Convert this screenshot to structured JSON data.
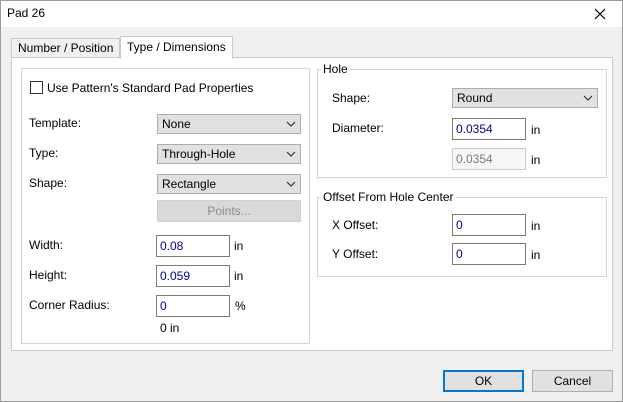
{
  "window": {
    "title": "Pad 26"
  },
  "tabs": [
    {
      "label": "Number / Position"
    },
    {
      "label": "Type / Dimensions"
    }
  ],
  "pad": {
    "use_standard_label": "Use Pattern's Standard Pad Properties",
    "use_standard_checked": false,
    "template_label": "Template:",
    "template_value": "None",
    "type_label": "Type:",
    "type_value": "Through-Hole",
    "shape_label": "Shape:",
    "shape_value": "Rectangle",
    "points_button": "Points...",
    "width_label": "Width:",
    "width_value": "0.08",
    "width_unit": "in",
    "height_label": "Height:",
    "height_value": "0.059",
    "height_unit": "in",
    "corner_label": "Corner Radius:",
    "corner_value": "0",
    "corner_unit": "%",
    "corner_computed": "0 in"
  },
  "hole": {
    "group_title": "Hole",
    "shape_label": "Shape:",
    "shape_value": "Round",
    "diameter_label": "Diameter:",
    "diameter_value": "0.0354",
    "diameter_unit": "in",
    "secondary_value": "0.0354",
    "secondary_unit": "in"
  },
  "offset": {
    "group_title": "Offset From Hole Center",
    "x_label": "X Offset:",
    "x_value": "0",
    "x_unit": "in",
    "y_label": "Y Offset:",
    "y_value": "0",
    "y_unit": "in"
  },
  "buttons": {
    "ok": "OK",
    "cancel": "Cancel"
  }
}
